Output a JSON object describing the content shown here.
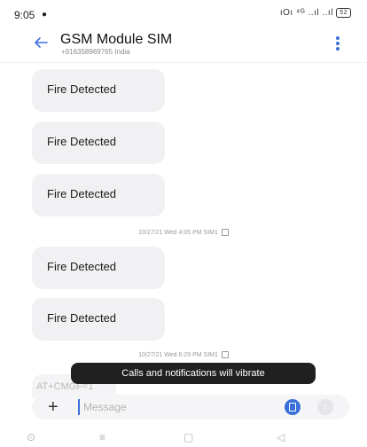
{
  "status_bar": {
    "time": "9:05",
    "notification_icon": "whatsapp-icon",
    "indicators": "ıOı ⁴ᴳ ..ıl ..ıl",
    "battery": "52"
  },
  "header": {
    "back_icon": "arrow-left-icon",
    "title": "GSM Module SIM",
    "subtitle": "+916358969765  India",
    "menu_icon": "more-vertical-icon",
    "accent_color": "#3b6fd8"
  },
  "messages": [
    {
      "text": "Fire Detected"
    },
    {
      "text": "Fire Detected"
    },
    {
      "text": "Fire Detected"
    },
    {
      "text": "Fire Detected"
    },
    {
      "text": "Fire Detected"
    }
  ],
  "timestamps": [
    {
      "text": "10/27/21 Wed 4:05 PM  SIM1"
    },
    {
      "text": "10/27/21 Wed 6:29 PM  SIM1"
    }
  ],
  "draft_text": "AT+CMGF=1",
  "toast": "Calls and notifications will vibrate",
  "composer": {
    "add_icon": "+",
    "placeholder": "Message",
    "sim_icon": "sim-icon",
    "send_icon": "↑"
  },
  "nav_bar": {
    "home": "⊙",
    "menu": "≡",
    "recents": "▢",
    "back": "◁"
  }
}
